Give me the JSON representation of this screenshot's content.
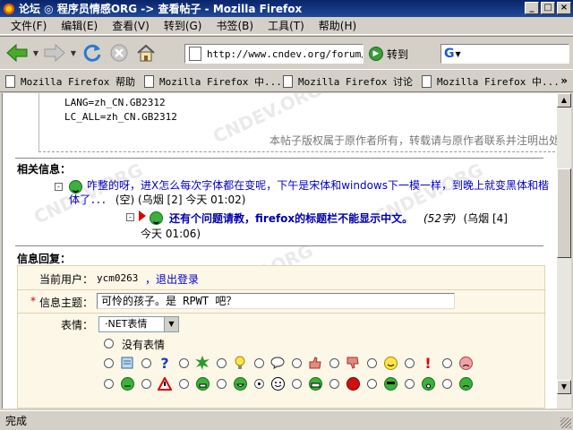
{
  "window": {
    "title": "论坛 ◎ 程序员情感ORG -> 查看帖子 - Mozilla Firefox",
    "minimize": "_",
    "maximize": "□",
    "close": "×"
  },
  "menu": [
    "文件(F)",
    "编辑(E)",
    "查看(V)",
    "转到(G)",
    "书签(B)",
    "工具(T)",
    "帮助(H)"
  ],
  "toolbar": {
    "url": "http://www.cndev.org/forum/ms",
    "go_label": "转到",
    "search_placeholder": ""
  },
  "bookmarks": {
    "items": [
      "Mozilla Firefox 帮助",
      "Mozilla Firefox 中...",
      "Mozilla Firefox 讨论",
      "Mozilla Firefox 中..."
    ],
    "more": "»"
  },
  "content": {
    "watermark": "CNDEV.ORG",
    "code_lines": [
      "LANG=zh_CN.GB2312",
      "LC_ALL=zh_CN.GB2312"
    ],
    "copyright": "本帖子版权属于原作者所有，转载请与原作者联系并注明出处",
    "related_title": "相关信息：",
    "related": [
      {
        "title_line1": "咋整的呀，进X怎么每次字体都在变呢，下午是宋体和windows下一模一样，到晚上就变黑体和楷",
        "title_line2": "体了．．．",
        "meta": "(空) (乌烟 [2] 今天 01:02)"
      },
      {
        "title": "还有个问题请教，firefox的标题栏不能显示中文。",
        "size": "(52字)",
        "meta_author": "(乌烟 [4]",
        "meta_time": "今天 01:06)"
      }
    ],
    "reply_title": "信息回复：",
    "reply": {
      "current_user_label": "当前用户：",
      "current_user": "ycm0263",
      "logout": "，退出登录",
      "required_mark": "*",
      "subject_label": "信息主题：",
      "subject_value": "可怜的孩子。是 RPWT 吧？",
      "emotion_label": "表情：",
      "emotion_select": "·NET表情",
      "no_emotion": "没有表情"
    }
  },
  "status": {
    "text": "完成"
  },
  "colors": {
    "titlebar": "#0a246a",
    "link": "#0000cc",
    "reply_bg": "#fdf7e7",
    "required": "#cc0000"
  }
}
